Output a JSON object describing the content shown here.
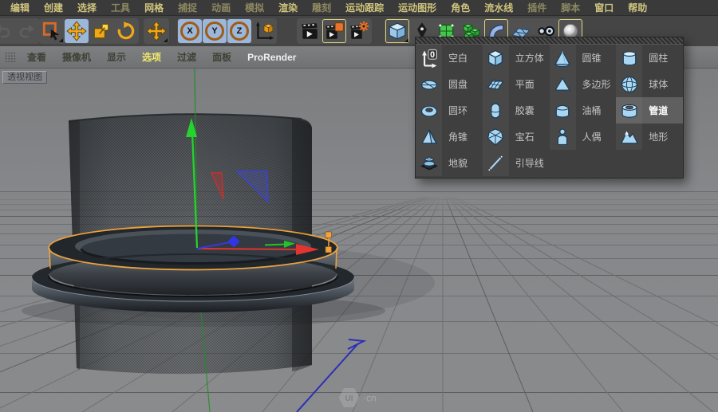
{
  "menubar": {
    "items": [
      {
        "label": "编辑",
        "dim": false
      },
      {
        "label": "创建",
        "dim": false
      },
      {
        "label": "选择",
        "dim": false
      },
      {
        "label": "工具",
        "dim": true
      },
      {
        "label": "网格",
        "dim": false
      },
      {
        "label": "捕捉",
        "dim": true
      },
      {
        "label": "动画",
        "dim": true
      },
      {
        "label": "模拟",
        "dim": true
      },
      {
        "label": "渲染",
        "dim": false
      },
      {
        "label": "雕刻",
        "dim": true
      },
      {
        "label": "运动跟踪",
        "dim": false
      },
      {
        "label": "运动图形",
        "dim": false
      },
      {
        "label": "角色",
        "dim": false
      },
      {
        "label": "流水线",
        "dim": false
      },
      {
        "label": "插件",
        "dim": true
      },
      {
        "label": "脚本",
        "dim": true
      },
      {
        "label": "窗口",
        "dim": false
      },
      {
        "label": "帮助",
        "dim": false
      }
    ]
  },
  "toolbar": {
    "axis_locks": [
      {
        "label": "X"
      },
      {
        "label": "Y"
      },
      {
        "label": "Z"
      }
    ],
    "icons": [
      "undo",
      "redo",
      "live-selection",
      "move",
      "scale",
      "rotate",
      "axis-move",
      "x-lock",
      "y-lock",
      "z-lock",
      "coordinate-system",
      "render-view",
      "render-to-picture-viewer",
      "edit-render-settings",
      "primitive-cube",
      "spline-pen",
      "subdivision-surface",
      "generator",
      "bend-deformer",
      "floor",
      "camera",
      "light"
    ],
    "active_tool": "move",
    "highlight_color": "#9cb7da"
  },
  "viewport_menu": {
    "items": [
      {
        "label": "查看"
      },
      {
        "label": "摄像机"
      },
      {
        "label": "显示"
      },
      {
        "label": "选项",
        "active": true
      },
      {
        "label": "过滤"
      },
      {
        "label": "面板"
      },
      {
        "label": "ProRender",
        "bright": true
      }
    ]
  },
  "viewport": {
    "view_label": "透视视图"
  },
  "primitives_panel": {
    "items": [
      {
        "label": "空白",
        "icon": "null",
        "glyph": "0"
      },
      {
        "label": "立方体",
        "icon": "cube"
      },
      {
        "label": "圆锥",
        "icon": "cone"
      },
      {
        "label": "圆柱",
        "icon": "cylinder"
      },
      {
        "label": "圆盘",
        "icon": "disc"
      },
      {
        "label": "平面",
        "icon": "plane"
      },
      {
        "label": "多边形",
        "icon": "polygon"
      },
      {
        "label": "球体",
        "icon": "sphere"
      },
      {
        "label": "圆环",
        "icon": "torus"
      },
      {
        "label": "胶囊",
        "icon": "capsule"
      },
      {
        "label": "油桶",
        "icon": "oil-tank"
      },
      {
        "label": "管道",
        "icon": "tube",
        "selected": true
      },
      {
        "label": "角锥",
        "icon": "pyramid"
      },
      {
        "label": "宝石",
        "icon": "gem"
      },
      {
        "label": "人偶",
        "icon": "figure"
      },
      {
        "label": "地形",
        "icon": "landscape"
      },
      {
        "label": "地貌",
        "icon": "relief"
      },
      {
        "label": "引导线",
        "icon": "guide"
      }
    ],
    "selected_label": "管道"
  },
  "watermark": {
    "badge": "UI",
    "suffix": "·cn"
  },
  "colors": {
    "selection_outline": "#f2a33c",
    "axis_x": "#e23430",
    "axis_y": "#26d32e",
    "axis_z": "#3339e0",
    "menubar_text": "#d0c57e",
    "panel_highlight": "#5f5f5f",
    "primitive_icon_blue": "#a9d7f3",
    "tool_yellow": "#f0a818"
  }
}
